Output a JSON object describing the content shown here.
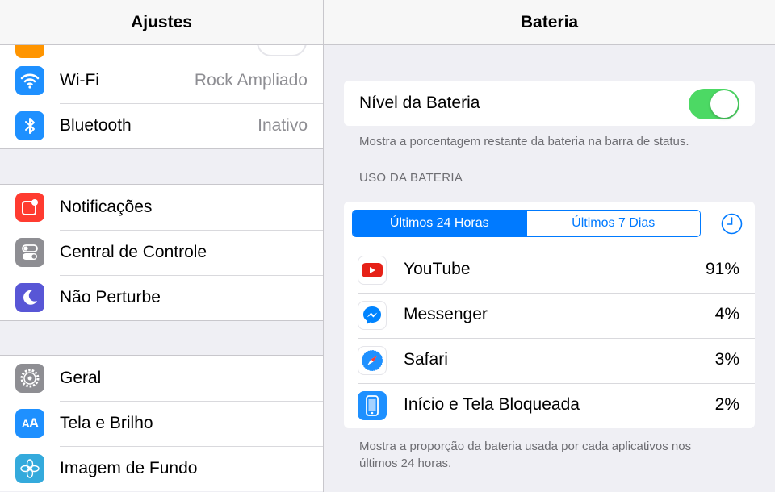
{
  "settings": {
    "title": "Ajustes",
    "network": [
      {
        "label": "Wi-Fi",
        "value": "Rock Ampliado"
      },
      {
        "label": "Bluetooth",
        "value": "Inativo"
      }
    ],
    "system": [
      {
        "label": "Notificações"
      },
      {
        "label": "Central de Controle"
      },
      {
        "label": "Não Perturbe"
      }
    ],
    "general": [
      {
        "label": "Geral"
      },
      {
        "label": "Tela e Brilho"
      },
      {
        "label": "Imagem de Fundo"
      }
    ]
  },
  "battery": {
    "title": "Bateria",
    "level_label": "Nível da Bateria",
    "level_on": true,
    "level_footer": "Mostra a porcentagem restante da bateria na barra de status.",
    "usage_header": "USO DA BATERIA",
    "tabs": [
      "Últimos 24 Horas",
      "Últimos 7 Dias"
    ],
    "apps": [
      {
        "name": "YouTube",
        "percent": "91%",
        "icon": "youtube-icon"
      },
      {
        "name": "Messenger",
        "percent": "4%",
        "icon": "messenger-icon"
      },
      {
        "name": "Safari",
        "percent": "3%",
        "icon": "safari-icon"
      },
      {
        "name": "Início e Tela Bloqueada",
        "percent": "2%",
        "icon": "home-lock-icon"
      }
    ],
    "usage_footer_line1": "Mostra a proporção da bateria usada por cada aplicativos nos",
    "usage_footer_line2": "últimos 24 horas."
  },
  "colors": {
    "accent": "#007aff",
    "toggle_on": "#4cd964",
    "wifi": "#1e90ff",
    "notifications": "#ff3b30",
    "control_center": "#8e8e93",
    "dnd": "#5856d6",
    "wallpaper": "#34aadc"
  }
}
